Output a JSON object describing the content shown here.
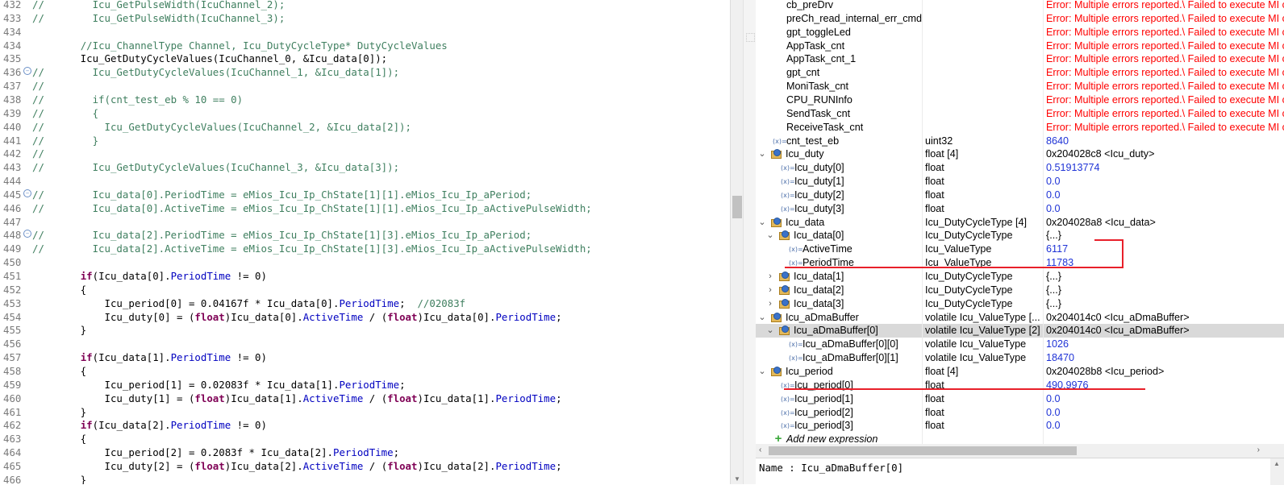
{
  "editor": {
    "lines": [
      {
        "num": "432",
        "segs": [
          [
            "cm",
            "//        Icu_GetPulseWidth(IcuChannel_2);"
          ]
        ]
      },
      {
        "num": "433",
        "segs": [
          [
            "cm",
            "//        Icu_GetPulseWidth(IcuChannel_3);"
          ]
        ]
      },
      {
        "num": "434",
        "segs": []
      },
      {
        "num": "434",
        "segs": [
          [
            "plain",
            "        "
          ],
          [
            "cm",
            "//Icu_ChannelType Channel, Icu_DutyCycleType* DutyCycleValues"
          ]
        ]
      },
      {
        "num": "435",
        "segs": [
          [
            "plain",
            "        Icu_GetDutyCycleValues(IcuChannel_0, &Icu_data[0]);"
          ]
        ]
      },
      {
        "num": "436",
        "fold": true,
        "segs": [
          [
            "cm",
            "//        Icu_GetDutyCycleValues(IcuChannel_1, &Icu_data[1]);"
          ]
        ]
      },
      {
        "num": "437",
        "segs": [
          [
            "cm",
            "//"
          ]
        ]
      },
      {
        "num": "438",
        "segs": [
          [
            "cm",
            "//        if(cnt_test_eb % 10 == 0)"
          ]
        ]
      },
      {
        "num": "439",
        "segs": [
          [
            "cm",
            "//        {"
          ]
        ]
      },
      {
        "num": "440",
        "segs": [
          [
            "cm",
            "//          Icu_GetDutyCycleValues(IcuChannel_2, &Icu_data[2]);"
          ]
        ]
      },
      {
        "num": "441",
        "segs": [
          [
            "cm",
            "//        }"
          ]
        ]
      },
      {
        "num": "442",
        "segs": [
          [
            "cm",
            "//"
          ]
        ]
      },
      {
        "num": "443",
        "segs": [
          [
            "cm",
            "//        Icu_GetDutyCycleValues(IcuChannel_3, &Icu_data[3]);"
          ]
        ]
      },
      {
        "num": "444",
        "segs": []
      },
      {
        "num": "445",
        "fold": true,
        "segs": [
          [
            "cm",
            "//        Icu_data[0].PeriodTime = eMios_Icu_Ip_ChState[1][1].eMios_Icu_Ip_aPeriod;"
          ]
        ]
      },
      {
        "num": "446",
        "segs": [
          [
            "cm",
            "//        Icu_data[0].ActiveTime = eMios_Icu_Ip_ChState[1][1].eMios_Icu_Ip_aActivePulseWidth;"
          ]
        ]
      },
      {
        "num": "447",
        "segs": []
      },
      {
        "num": "448",
        "fold": true,
        "segs": [
          [
            "cm",
            "//        Icu_data[2].PeriodTime = eMios_Icu_Ip_ChState[1][3].eMios_Icu_Ip_aPeriod;"
          ]
        ]
      },
      {
        "num": "449",
        "segs": [
          [
            "cm",
            "//        Icu_data[2].ActiveTime = eMios_Icu_Ip_ChState[1][3].eMios_Icu_Ip_aActivePulseWidth;"
          ]
        ]
      },
      {
        "num": "450",
        "segs": []
      },
      {
        "num": "451",
        "segs": [
          [
            "plain",
            "        "
          ],
          [
            "kw",
            "if"
          ],
          [
            "plain",
            "(Icu_data[0]."
          ],
          [
            "fld",
            "PeriodTime"
          ],
          [
            "plain",
            " != 0)"
          ]
        ]
      },
      {
        "num": "452",
        "segs": [
          [
            "plain",
            "        {"
          ]
        ]
      },
      {
        "num": "453",
        "segs": [
          [
            "plain",
            "            Icu_period[0] = 0.04167f * Icu_data[0]."
          ],
          [
            "fld",
            "PeriodTime"
          ],
          [
            "plain",
            ";  "
          ],
          [
            "cm",
            "//02083f"
          ]
        ]
      },
      {
        "num": "454",
        "segs": [
          [
            "plain",
            "            Icu_duty[0] = ("
          ],
          [
            "kw",
            "float"
          ],
          [
            "plain",
            ")Icu_data[0]."
          ],
          [
            "fld",
            "ActiveTime"
          ],
          [
            "plain",
            " / ("
          ],
          [
            "kw",
            "float"
          ],
          [
            "plain",
            ")Icu_data[0]."
          ],
          [
            "fld",
            "PeriodTime"
          ],
          [
            "plain",
            ";"
          ]
        ]
      },
      {
        "num": "455",
        "segs": [
          [
            "plain",
            "        }"
          ]
        ]
      },
      {
        "num": "456",
        "segs": []
      },
      {
        "num": "457",
        "segs": [
          [
            "plain",
            "        "
          ],
          [
            "kw",
            "if"
          ],
          [
            "plain",
            "(Icu_data[1]."
          ],
          [
            "fld",
            "PeriodTime"
          ],
          [
            "plain",
            " != 0)"
          ]
        ]
      },
      {
        "num": "458",
        "segs": [
          [
            "plain",
            "        {"
          ]
        ]
      },
      {
        "num": "459",
        "segs": [
          [
            "plain",
            "            Icu_period[1] = 0.02083f * Icu_data[1]."
          ],
          [
            "fld",
            "PeriodTime"
          ],
          [
            "plain",
            ";"
          ]
        ]
      },
      {
        "num": "460",
        "segs": [
          [
            "plain",
            "            Icu_duty[1] = ("
          ],
          [
            "kw",
            "float"
          ],
          [
            "plain",
            ")Icu_data[1]."
          ],
          [
            "fld",
            "ActiveTime"
          ],
          [
            "plain",
            " / ("
          ],
          [
            "kw",
            "float"
          ],
          [
            "plain",
            ")Icu_data[1]."
          ],
          [
            "fld",
            "PeriodTime"
          ],
          [
            "plain",
            ";"
          ]
        ]
      },
      {
        "num": "461",
        "segs": [
          [
            "plain",
            "        }"
          ]
        ]
      },
      {
        "num": "462",
        "segs": [
          [
            "plain",
            "        "
          ],
          [
            "kw",
            "if"
          ],
          [
            "plain",
            "(Icu_data[2]."
          ],
          [
            "fld",
            "PeriodTime"
          ],
          [
            "plain",
            " != 0)"
          ]
        ]
      },
      {
        "num": "463",
        "segs": [
          [
            "plain",
            "        {"
          ]
        ]
      },
      {
        "num": "464",
        "segs": [
          [
            "plain",
            "            Icu_period[2] = 0.2083f * Icu_data[2]."
          ],
          [
            "fld",
            "PeriodTime"
          ],
          [
            "plain",
            ";"
          ]
        ]
      },
      {
        "num": "465",
        "segs": [
          [
            "plain",
            "            Icu_duty[2] = ("
          ],
          [
            "kw",
            "float"
          ],
          [
            "plain",
            ")Icu_data[2]."
          ],
          [
            "fld",
            "ActiveTime"
          ],
          [
            "plain",
            " / ("
          ],
          [
            "kw",
            "float"
          ],
          [
            "plain",
            ")Icu_data[2]."
          ],
          [
            "fld",
            "PeriodTime"
          ],
          [
            "plain",
            ";"
          ]
        ]
      },
      {
        "num": "466",
        "segs": [
          [
            "plain",
            "        }"
          ]
        ]
      }
    ]
  },
  "expressions": {
    "rows": [
      {
        "depth": 0,
        "icon": "none",
        "name": "cb_preDrv",
        "type": "",
        "value": "Error: Multiple errors reported.\\ Failed to execute MI command:",
        "vstyle": "err"
      },
      {
        "depth": 0,
        "icon": "none",
        "name": "preCh_read_internal_err_cmd",
        "type": "",
        "value": "Error: Multiple errors reported.\\ Failed to execute MI command:",
        "vstyle": "err"
      },
      {
        "depth": 0,
        "icon": "none",
        "name": "gpt_toggleLed",
        "type": "",
        "value": "Error: Multiple errors reported.\\ Failed to execute MI command:",
        "vstyle": "err"
      },
      {
        "depth": 0,
        "icon": "none",
        "name": "AppTask_cnt",
        "type": "",
        "value": "Error: Multiple errors reported.\\ Failed to execute MI command:",
        "vstyle": "err"
      },
      {
        "depth": 0,
        "icon": "none",
        "name": "AppTask_cnt_1",
        "type": "",
        "value": "Error: Multiple errors reported.\\ Failed to execute MI command:",
        "vstyle": "err"
      },
      {
        "depth": 0,
        "icon": "none",
        "name": "gpt_cnt",
        "type": "",
        "value": "Error: Multiple errors reported.\\ Failed to execute MI command:",
        "vstyle": "err"
      },
      {
        "depth": 0,
        "icon": "none",
        "name": "MoniTask_cnt",
        "type": "",
        "value": "Error: Multiple errors reported.\\ Failed to execute MI command:",
        "vstyle": "err"
      },
      {
        "depth": 0,
        "icon": "none",
        "name": "CPU_RUNInfo",
        "type": "",
        "value": "Error: Multiple errors reported.\\ Failed to execute MI command:",
        "vstyle": "err"
      },
      {
        "depth": 0,
        "icon": "none",
        "name": "SendTask_cnt",
        "type": "",
        "value": "Error: Multiple errors reported.\\ Failed to execute MI command:",
        "vstyle": "err"
      },
      {
        "depth": 0,
        "icon": "none",
        "name": "ReceiveTask_cnt",
        "type": "",
        "value": "Error: Multiple errors reported.\\ Failed to execute MI command:",
        "vstyle": "err"
      },
      {
        "depth": 0,
        "icon": "var",
        "name": "cnt_test_eb",
        "type": "uint32",
        "value": "8640",
        "vstyle": "blue"
      },
      {
        "depth": 0,
        "icon": "struct",
        "expand": "down",
        "name": "Icu_duty",
        "type": "float [4]",
        "value": "0x204028c8 <Icu_duty>",
        "vstyle": "plain"
      },
      {
        "depth": 1,
        "icon": "var",
        "name": "Icu_duty[0]",
        "type": "float",
        "value": "0.51913774",
        "vstyle": "blue"
      },
      {
        "depth": 1,
        "icon": "var",
        "name": "Icu_duty[1]",
        "type": "float",
        "value": "0.0",
        "vstyle": "blue"
      },
      {
        "depth": 1,
        "icon": "var",
        "name": "Icu_duty[2]",
        "type": "float",
        "value": "0.0",
        "vstyle": "blue"
      },
      {
        "depth": 1,
        "icon": "var",
        "name": "Icu_duty[3]",
        "type": "float",
        "value": "0.0",
        "vstyle": "blue"
      },
      {
        "depth": 0,
        "icon": "struct",
        "expand": "down",
        "name": "Icu_data",
        "type": "Icu_DutyCycleType [4]",
        "value": "0x204028a8 <Icu_data>",
        "vstyle": "plain"
      },
      {
        "depth": 1,
        "icon": "struct",
        "expand": "down",
        "name": "Icu_data[0]",
        "type": "Icu_DutyCycleType",
        "value": "{...}",
        "vstyle": "plain"
      },
      {
        "depth": 2,
        "icon": "var",
        "name": "ActiveTime",
        "type": "Icu_ValueType",
        "value": "6117",
        "vstyle": "blue"
      },
      {
        "depth": 2,
        "icon": "var",
        "name": "PeriodTime",
        "type": "Icu_ValueType",
        "value": "11783",
        "vstyle": "blue"
      },
      {
        "depth": 1,
        "icon": "struct",
        "expand": "right",
        "name": "Icu_data[1]",
        "type": "Icu_DutyCycleType",
        "value": "{...}",
        "vstyle": "plain"
      },
      {
        "depth": 1,
        "icon": "struct",
        "expand": "right",
        "name": "Icu_data[2]",
        "type": "Icu_DutyCycleType",
        "value": "{...}",
        "vstyle": "plain"
      },
      {
        "depth": 1,
        "icon": "struct",
        "expand": "right",
        "name": "Icu_data[3]",
        "type": "Icu_DutyCycleType",
        "value": "{...}",
        "vstyle": "plain"
      },
      {
        "depth": 0,
        "icon": "struct",
        "expand": "down",
        "name": "Icu_aDmaBuffer",
        "type": "volatile Icu_ValueType [...",
        "value": "0x204014c0 <Icu_aDmaBuffer>",
        "vstyle": "plain"
      },
      {
        "depth": 1,
        "icon": "struct",
        "expand": "down",
        "name": "Icu_aDmaBuffer[0]",
        "type": "volatile Icu_ValueType [2]",
        "value": "0x204014c0 <Icu_aDmaBuffer>",
        "vstyle": "plain",
        "selected": true
      },
      {
        "depth": 2,
        "icon": "var",
        "name": "Icu_aDmaBuffer[0][0]",
        "type": "volatile Icu_ValueType",
        "value": "1026",
        "vstyle": "blue"
      },
      {
        "depth": 2,
        "icon": "var",
        "name": "Icu_aDmaBuffer[0][1]",
        "type": "volatile Icu_ValueType",
        "value": "18470",
        "vstyle": "blue"
      },
      {
        "depth": 0,
        "icon": "struct",
        "expand": "down",
        "name": "Icu_period",
        "type": "float [4]",
        "value": "0x204028b8 <Icu_period>",
        "vstyle": "plain"
      },
      {
        "depth": 1,
        "icon": "var",
        "name": "Icu_period[0]",
        "type": "float",
        "value": "490.9976",
        "vstyle": "blue"
      },
      {
        "depth": 1,
        "icon": "var",
        "name": "Icu_period[1]",
        "type": "float",
        "value": "0.0",
        "vstyle": "blue"
      },
      {
        "depth": 1,
        "icon": "var",
        "name": "Icu_period[2]",
        "type": "float",
        "value": "0.0",
        "vstyle": "blue"
      },
      {
        "depth": 1,
        "icon": "var",
        "name": "Icu_period[3]",
        "type": "float",
        "value": "0.0",
        "vstyle": "blue"
      },
      {
        "depth": 0,
        "icon": "add",
        "name": "Add new expression",
        "type": "",
        "value": "",
        "vstyle": "plain",
        "italic": true
      }
    ]
  },
  "details": {
    "text": "Name : Icu_aDmaBuffer[0]"
  },
  "icons": {
    "var_icon_glyph": "(x)=",
    "add_icon_glyph": "+",
    "fold_icon_glyph": "−",
    "expand_down_glyph": "⌄",
    "expand_right_glyph": "›",
    "scroll_left_glyph": "‹",
    "scroll_right_glyph": "›",
    "scroll_down_glyph": "▼",
    "scroll_up_glyph": "▲"
  },
  "colors": {
    "error_text": "#ff0000",
    "value_blue": "#1f33d6",
    "comment_green": "#3f7f5f",
    "keyword_purple": "#7f0055",
    "field_blue": "#0000c0",
    "annotation_red": "#e8202a",
    "selected_row": "#d9d9d9"
  }
}
